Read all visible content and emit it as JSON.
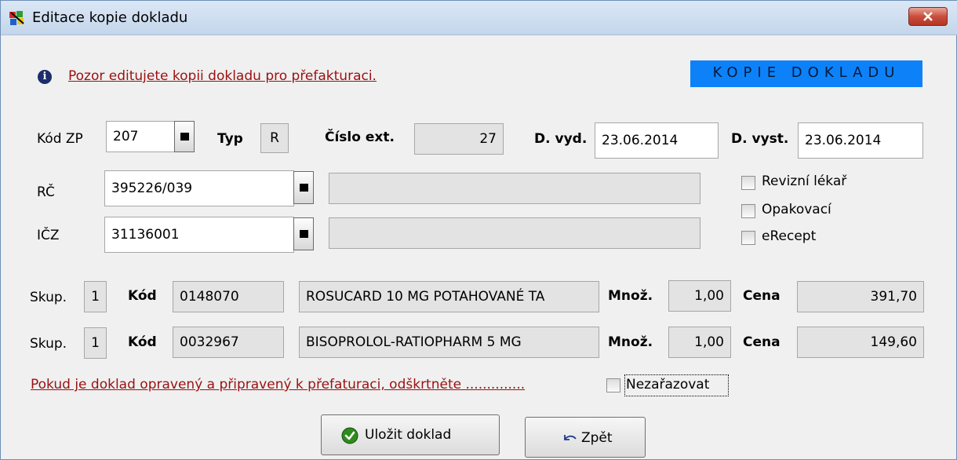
{
  "window": {
    "title": "Editace kopie dokladu",
    "close_icon": "close-icon",
    "app_icon": "app-icon"
  },
  "info": {
    "icon": "info-icon",
    "message": "Pozor editujete kopii dokladu pro přefakturaci."
  },
  "banner": {
    "text": "KOPIE DOKLADU",
    "bg_color": "#0d82f8"
  },
  "header_fields": {
    "kod_zp": {
      "label": "Kód ZP",
      "value": "207"
    },
    "typ": {
      "label": "Typ",
      "value": "R"
    },
    "cislo_ext": {
      "label": "Číslo ext.",
      "value": "27"
    },
    "d_vyd": {
      "label": "D. vyd.",
      "value": "23.06.2014"
    },
    "d_vyst": {
      "label": "D. vyst.",
      "value": "23.06.2014"
    }
  },
  "rc": {
    "label": "RČ",
    "value": "395226/039",
    "detail": ""
  },
  "icz": {
    "label": "IČZ",
    "value": "31136001",
    "detail": ""
  },
  "checkboxes": [
    {
      "label": "Revizní lékař",
      "checked": false
    },
    {
      "label": "Opakovací",
      "checked": false
    },
    {
      "label": "eRecept",
      "checked": false
    }
  ],
  "items": [
    {
      "skup_label": "Skup.",
      "skup": "1",
      "kod_label": "Kód",
      "kod": "0148070",
      "name": "ROSUCARD 10 MG POTAHOVANÉ TA",
      "mnoz_label": "Množ.",
      "mnoz": "1,00",
      "cena_label": "Cena",
      "cena": "391,70"
    },
    {
      "skup_label": "Skup.",
      "skup": "1",
      "kod_label": "Kód",
      "kod": "0032967",
      "name": "BISOPROLOL-RATIOPHARM 5 MG",
      "mnoz_label": "Množ.",
      "mnoz": "1,00",
      "cena_label": "Cena",
      "cena": "149,60"
    }
  ],
  "footer": {
    "note": "Pokud je doklad opravený a připravený k přefaturaci, odškrtněte ..............",
    "nezarazovat": {
      "label": "Nezařazovat",
      "checked": false
    }
  },
  "buttons": {
    "save": {
      "label": "Uložit doklad",
      "icon": "check-circle-icon"
    },
    "back": {
      "label": "Zpět",
      "icon": "undo-arrow-icon"
    }
  }
}
